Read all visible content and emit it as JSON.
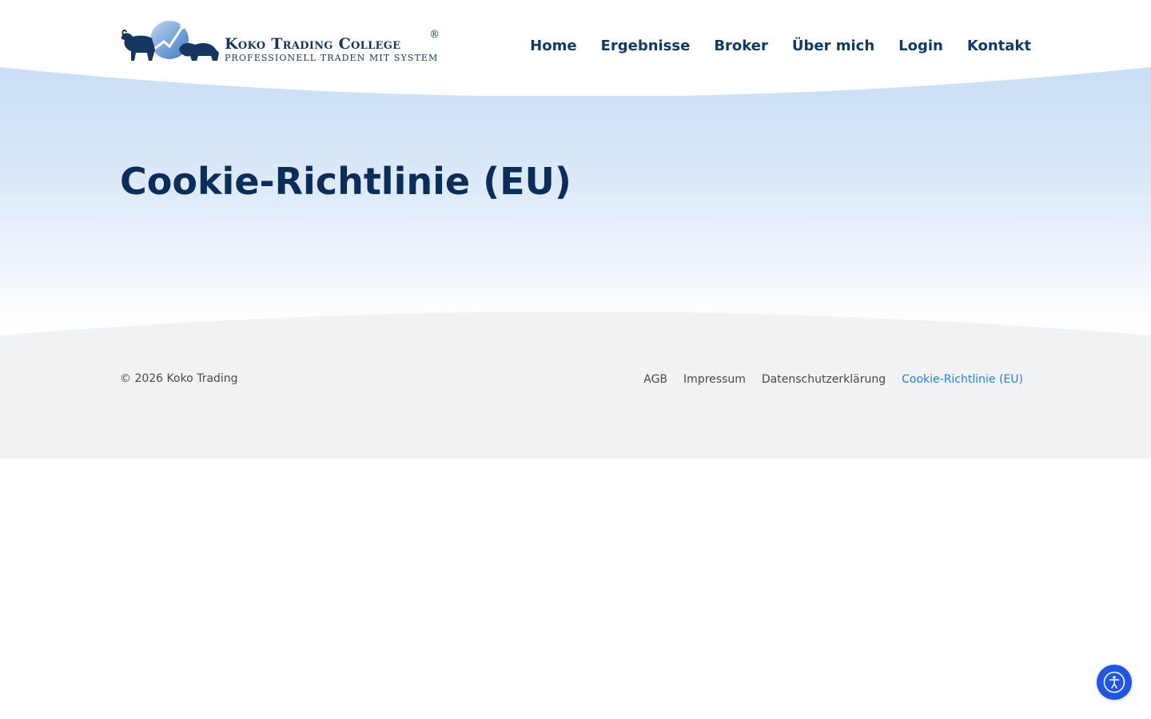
{
  "logo": {
    "title": "Koko Trading College",
    "registered_mark": "®",
    "tagline": "PROFESSIONELL TRADEN MIT SYSTEM"
  },
  "nav": {
    "items": [
      {
        "label": "Home"
      },
      {
        "label": "Ergebnisse"
      },
      {
        "label": "Broker"
      },
      {
        "label": "Über mich"
      },
      {
        "label": "Login"
      },
      {
        "label": "Kontakt"
      }
    ]
  },
  "main": {
    "title": "Cookie-Richtlinie (EU)"
  },
  "footer": {
    "copyright": "© 2026 Koko Trading",
    "links": [
      {
        "label": "AGB"
      },
      {
        "label": "Impressum"
      },
      {
        "label": "Datenschutzerklärung"
      },
      {
        "label": "Cookie-Richtlinie (EU)",
        "active": true
      }
    ]
  },
  "accessibility": {
    "icon": "accessibility-icon"
  },
  "colors": {
    "brand_navy": "#0e3a6b",
    "title_navy": "#0a2d59",
    "active_link": "#2a7fd4",
    "a11y_button": "#1f56e6",
    "hero_blue": "#c8def6",
    "footer_gray": "#f1f2f3"
  }
}
